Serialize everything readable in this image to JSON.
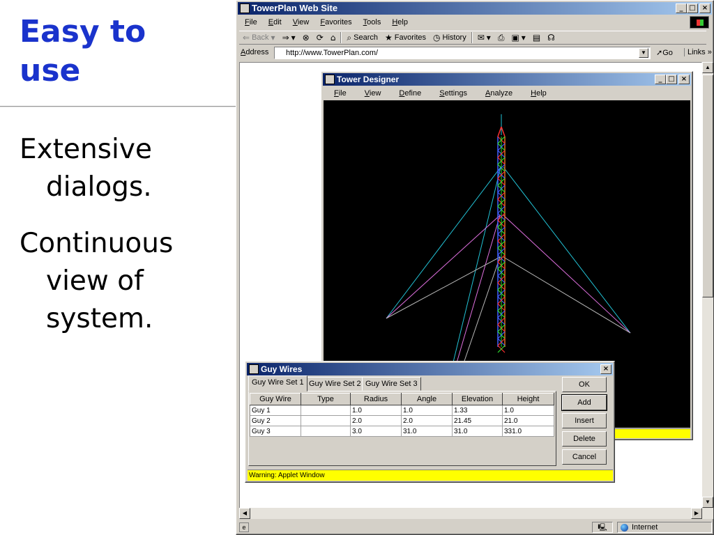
{
  "slide": {
    "title_line1": "Easy to",
    "title_line2": "use",
    "bullets": [
      {
        "line1": "Extensive",
        "line2": "dialogs."
      },
      {
        "line1": "Continuous",
        "line2": "view of",
        "line3": "system."
      }
    ]
  },
  "browser": {
    "title": "TowerPlan Web Site",
    "menu": [
      "File",
      "Edit",
      "View",
      "Favorites",
      "Tools",
      "Help"
    ],
    "toolbar": {
      "back": "Back",
      "search": "Search",
      "favorites": "Favorites",
      "history": "History"
    },
    "address_label": "Address",
    "address_value": "http://www.TowerPlan.com/",
    "go_label": "Go",
    "links_label": "Links",
    "status_zone": "Internet"
  },
  "tower_designer": {
    "title": "Tower Designer",
    "menu": [
      "File",
      "View",
      "Define",
      "Settings",
      "Analyze",
      "Help"
    ],
    "colors": {
      "guy_set_1": "#22c3d6",
      "guy_set_2": "#e070e0",
      "guy_set_3": "#b8b8b8",
      "lattice_red": "#ff3030",
      "lattice_green": "#30e030",
      "lattice_blue": "#4060ff",
      "mast": "#e07020"
    }
  },
  "guy_wires": {
    "title": "Guy Wires",
    "tabs": [
      "Guy Wire Set 1",
      "Guy Wire Set 2",
      "Guy Wire Set 3"
    ],
    "columns": [
      "Guy Wire",
      "Type",
      "Radius",
      "Angle",
      "Elevation",
      "Height"
    ],
    "rows": [
      [
        "Guy 1",
        "",
        "1.0",
        "1.0",
        "1.33",
        "1.0"
      ],
      [
        "Guy 2",
        "",
        "2.0",
        "2.0",
        "21.45",
        "21.0"
      ],
      [
        "Guy 3",
        "",
        "3.0",
        "31.0",
        "31.0",
        "331.0"
      ]
    ],
    "buttons": {
      "ok": "OK",
      "add": "Add",
      "insert": "Insert",
      "delete": "Delete",
      "cancel": "Cancel"
    },
    "warning": "Warning: Applet Window"
  }
}
